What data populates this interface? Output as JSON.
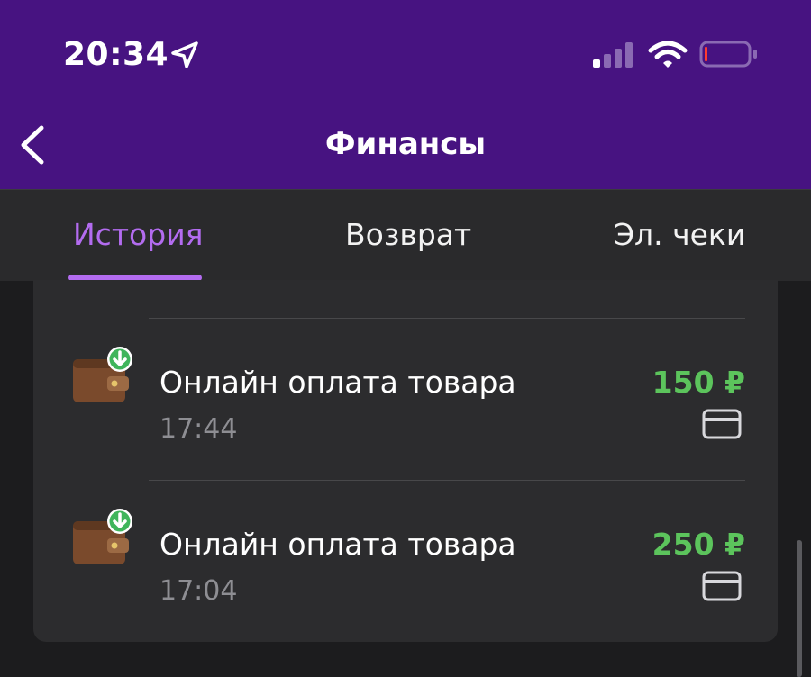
{
  "status_bar": {
    "time": "20:34",
    "icons": [
      "location-arrow-icon",
      "cellular-signal-icon",
      "wifi-icon",
      "battery-low-icon"
    ]
  },
  "header": {
    "title": "Финансы",
    "back_icon": "chevron-left-icon"
  },
  "tabs": [
    {
      "label": "История",
      "active": true
    },
    {
      "label": "Возврат",
      "active": false
    },
    {
      "label": "Эл. чеки",
      "active": false
    }
  ],
  "transactions": [
    {
      "title": "Онлайн оплата товара",
      "time": "17:44",
      "amount": "150 ₽",
      "icon": "wallet-incoming-icon",
      "method_icon": "bank-card-icon"
    },
    {
      "title": "Онлайн оплата товара",
      "time": "17:04",
      "amount": "250 ₽",
      "icon": "wallet-incoming-icon",
      "method_icon": "bank-card-icon"
    }
  ],
  "colors": {
    "header_bg": "#471381",
    "accent": "#b36cf0",
    "amount_green": "#5cc45c",
    "background": "#1c1c1e",
    "card_bg": "#2c2c2e"
  }
}
